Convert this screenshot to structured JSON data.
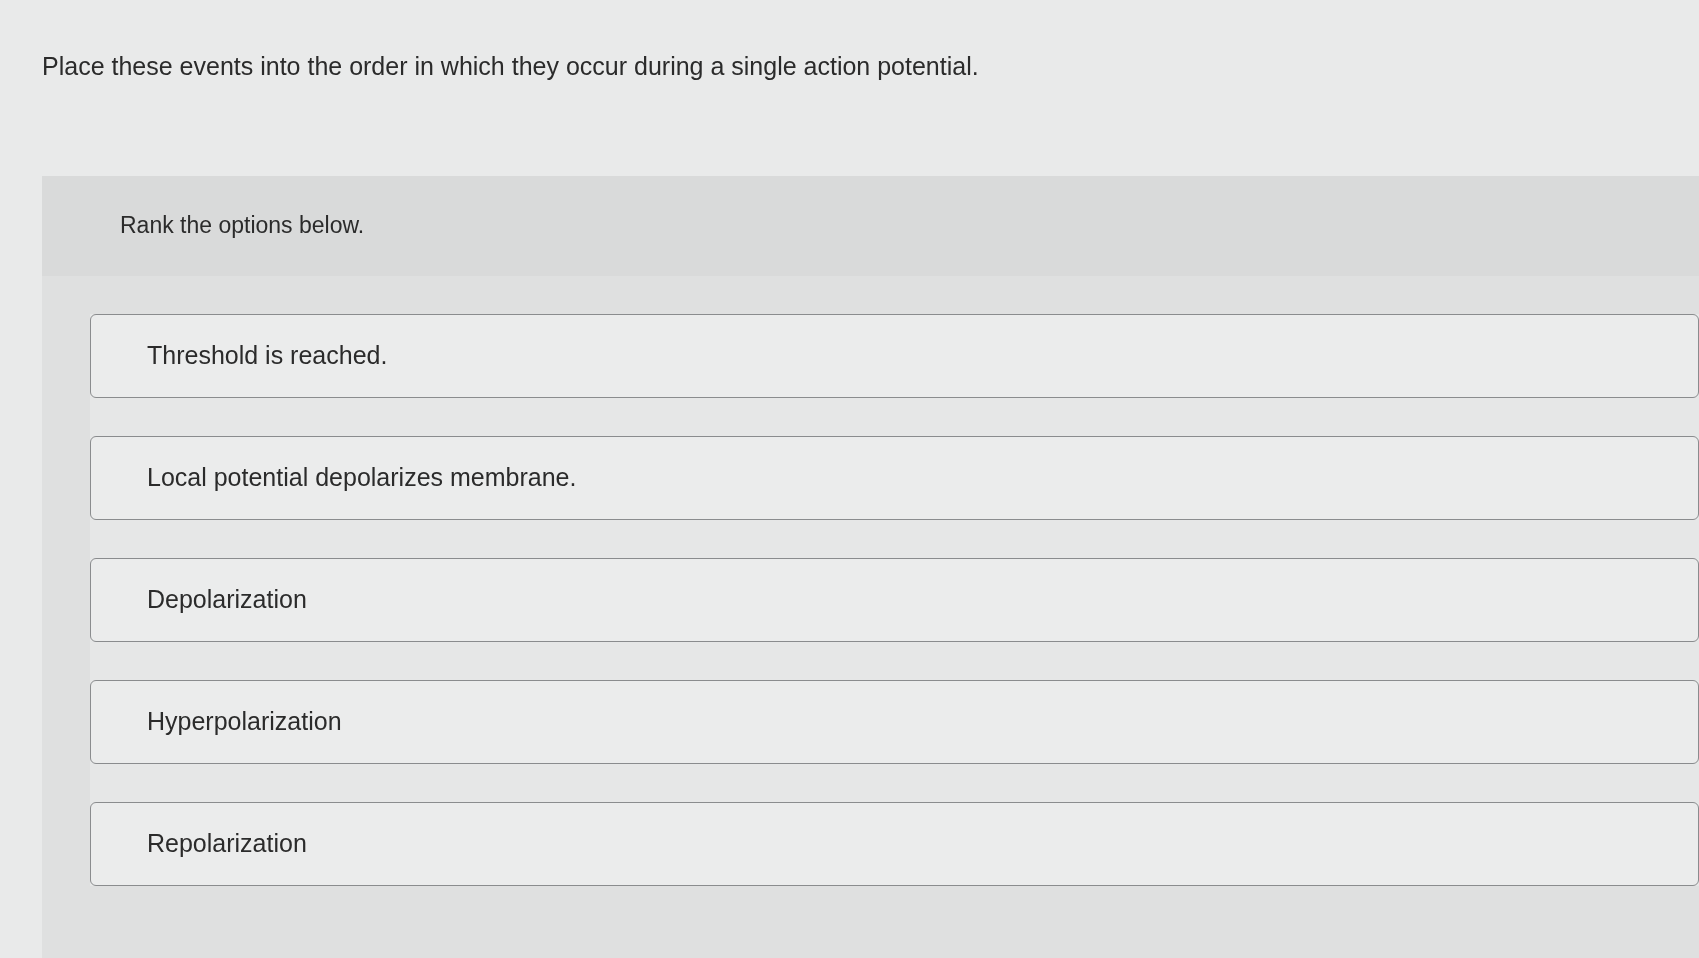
{
  "question": "Place these events into the order in which they occur during a single action potential.",
  "instruction": "Rank the options below.",
  "options": [
    {
      "label": "Threshold is reached."
    },
    {
      "label": "Local potential depolarizes membrane."
    },
    {
      "label": "Depolarization"
    },
    {
      "label": "Hyperpolarization"
    },
    {
      "label": "Repolarization"
    }
  ]
}
